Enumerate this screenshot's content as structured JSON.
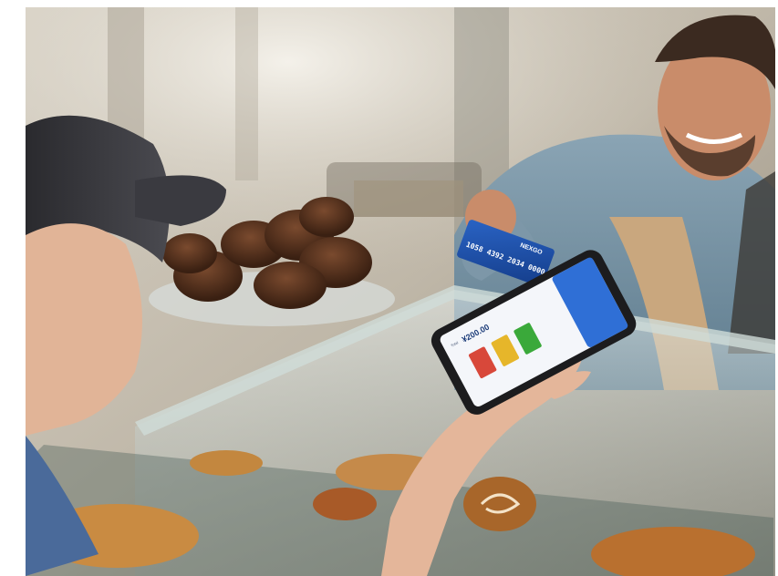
{
  "scene": {
    "description_label": "photo",
    "card": {
      "brand": "NEXGO",
      "number": "1058 4392 2034 0000"
    },
    "terminal": {
      "amount_prefix": "Total",
      "amount": "¥200.00"
    }
  },
  "colors": {
    "card_blue": "#1c4fa8",
    "screen_header": "#2f6fd6",
    "green_tile": "#3aa93a",
    "yellow_tile": "#e6b62a",
    "red_tile": "#d8483a"
  }
}
